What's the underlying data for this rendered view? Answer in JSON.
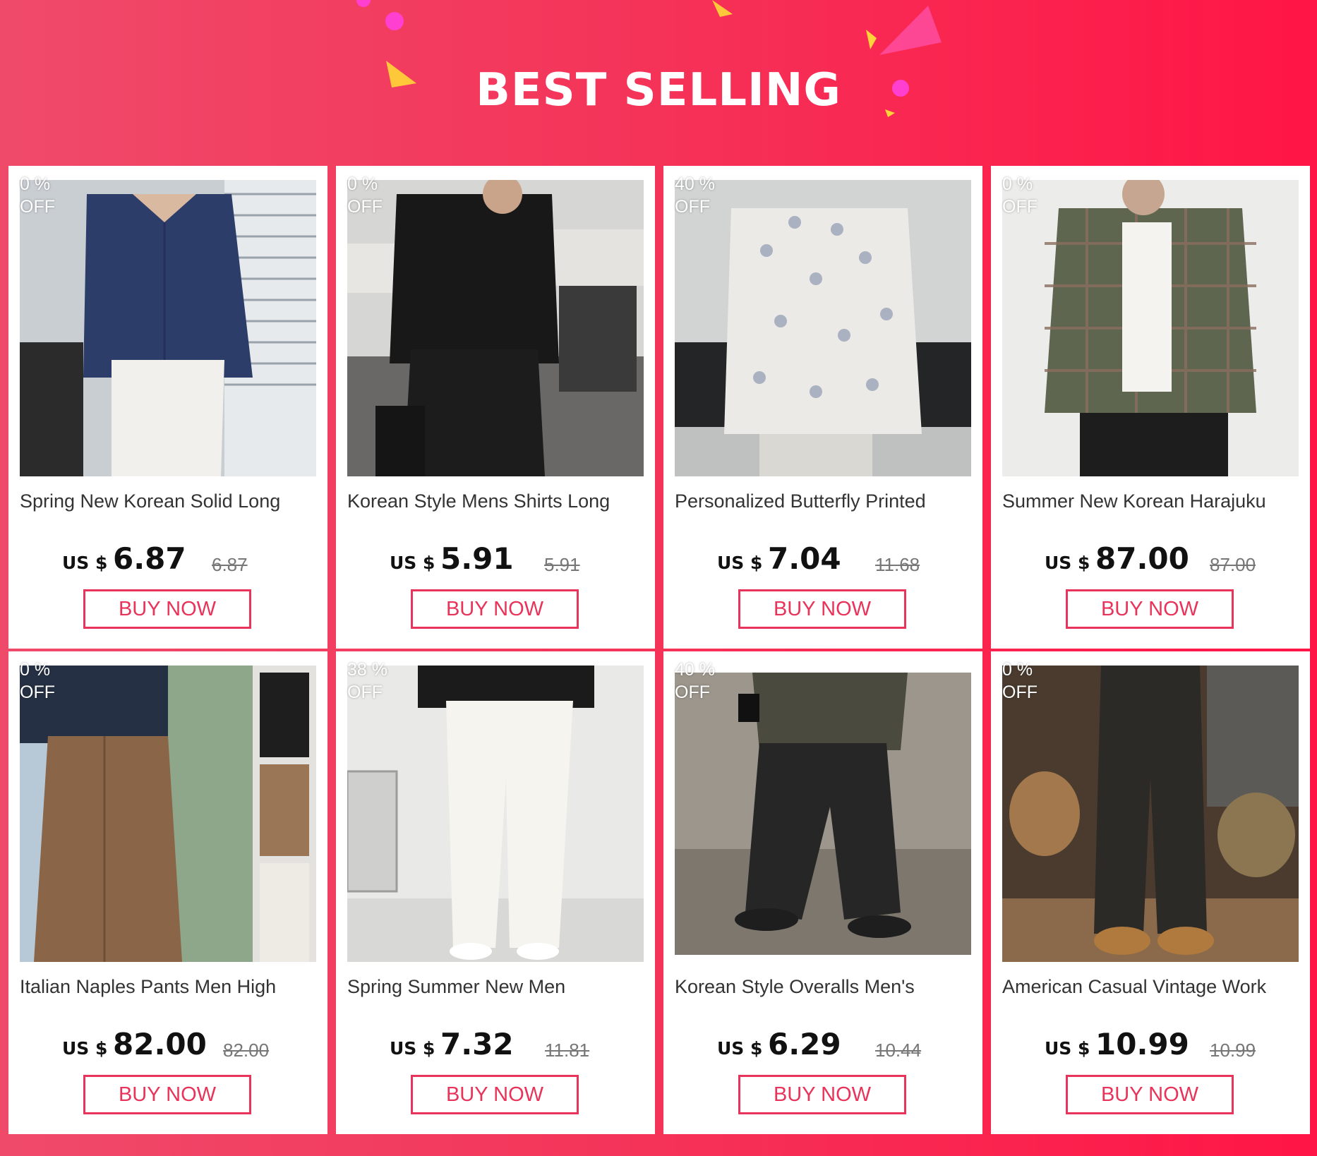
{
  "banner": {
    "title": "BEST SELLING"
  },
  "colors": {
    "accent": "#e8345a",
    "background_start": "#f04a6a",
    "background_end": "#ff1546"
  },
  "products": [
    {
      "discount_pct": "0  %",
      "discount_off": "OFF",
      "title": "Spring New Korean Solid Long",
      "currency": "US $",
      "price": "6.87",
      "old_price": "6.87",
      "buy_label": "BUY NOW"
    },
    {
      "discount_pct": "0  %",
      "discount_off": "OFF",
      "title": "Korean Style Mens Shirts Long",
      "currency": "US $",
      "price": "5.91",
      "old_price": "5.91",
      "buy_label": "BUY NOW"
    },
    {
      "discount_pct": "40  %",
      "discount_off": "OFF",
      "title": "Personalized Butterfly Printed",
      "currency": "US $",
      "price": "7.04",
      "old_price": "11.68",
      "buy_label": "BUY NOW"
    },
    {
      "discount_pct": "0  %",
      "discount_off": "OFF",
      "title": "Summer New Korean Harajuku",
      "currency": "US $",
      "price": "87.00",
      "old_price": "87.00",
      "buy_label": "BUY NOW"
    },
    {
      "discount_pct": "0  %",
      "discount_off": "OFF",
      "title": "Italian Naples Pants Men High",
      "currency": "US $",
      "price": "82.00",
      "old_price": "82.00",
      "buy_label": "BUY NOW"
    },
    {
      "discount_pct": "38  %",
      "discount_off": "OFF",
      "title": "Spring Summer New Men",
      "currency": "US $",
      "price": "7.32",
      "old_price": "11.81",
      "buy_label": "BUY NOW"
    },
    {
      "discount_pct": "40  %",
      "discount_off": "OFF",
      "title": "Korean Style Overalls Men's",
      "currency": "US $",
      "price": "6.29",
      "old_price": "10.44",
      "buy_label": "BUY NOW"
    },
    {
      "discount_pct": "0  %",
      "discount_off": "OFF",
      "title": "American Casual Vintage Work",
      "currency": "US $",
      "price": "10.99",
      "old_price": "10.99",
      "buy_label": "BUY NOW"
    }
  ]
}
